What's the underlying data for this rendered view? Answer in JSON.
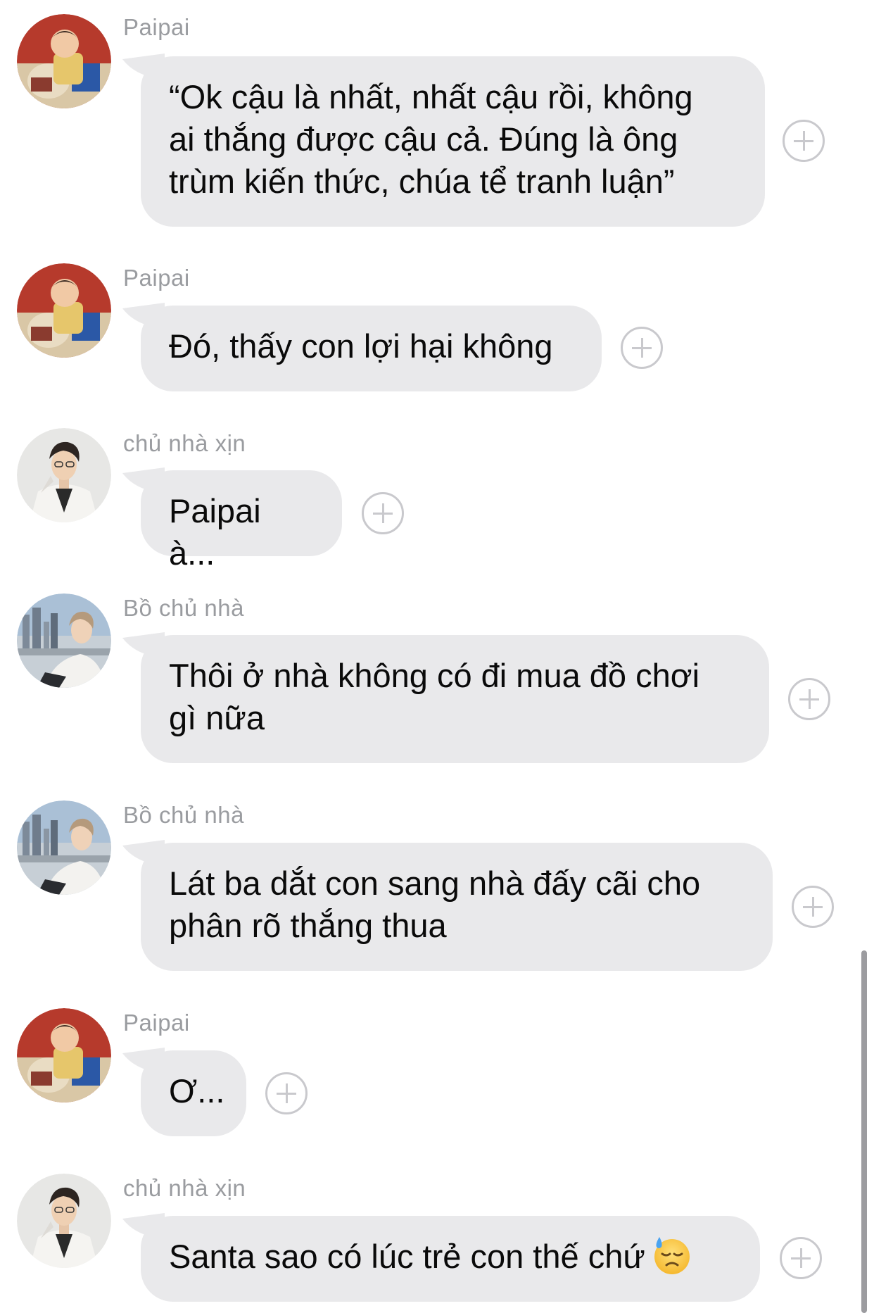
{
  "messages": [
    {
      "sender": "Paipai",
      "avatar": "paipai-avatar",
      "text": "“Ok cậu là nhất, nhất cậu rồi, không\nai thắng được cậu cả. Đúng là ông\ntrùm kiến thức, chúa tể tranh luận”"
    },
    {
      "sender": "Paipai",
      "avatar": "paipai-avatar",
      "text": "Đó, thấy con lợi hại không"
    },
    {
      "sender": "chủ nhà xịn",
      "avatar": "chu-nha-xin-avatar",
      "text": "Paipai à..."
    },
    {
      "sender": "Bồ chủ nhà",
      "avatar": "bo-chu-nha-avatar",
      "text": "Thôi ở nhà không có đi mua đồ chơi\ngì nữa"
    },
    {
      "sender": "Bồ chủ nhà",
      "avatar": "bo-chu-nha-avatar",
      "text": "Lát ba dắt con sang nhà đấy cãi cho\nphân rõ thắng thua"
    },
    {
      "sender": "Paipai",
      "avatar": "paipai-avatar",
      "text": "Ơ..."
    },
    {
      "sender": "chủ nhà xịn",
      "avatar": "chu-nha-xin-avatar",
      "text": "Santa sao có lúc trẻ con thế chứ",
      "emoji": "sweat-face-emoji"
    }
  ],
  "colors": {
    "bubble": "#e9e9eb",
    "sender": "#9a9ca0",
    "add_button": "#c9c9cd",
    "text": "#0a0a0a"
  },
  "icons": {
    "add_reaction": "plus-circle-icon"
  }
}
